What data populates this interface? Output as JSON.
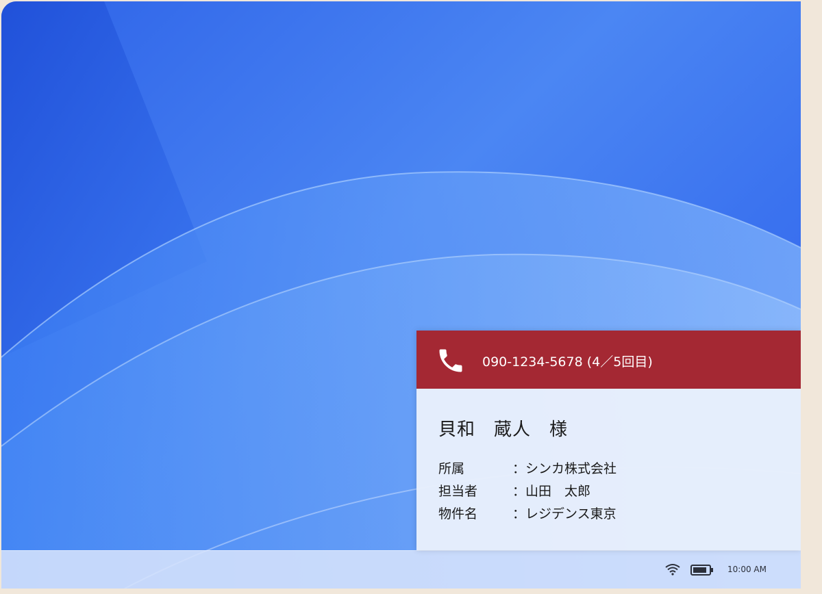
{
  "taskbar": {
    "wifi_icon": "wifi-icon",
    "battery_icon": "battery-icon",
    "clock": "10:00 AM"
  },
  "notification": {
    "accent_color": "#a42833",
    "icon": "phone-icon",
    "phone_line": "090-1234-5678 (4／5回目)",
    "caller_name": "貝和　蔵人　様",
    "separator": "：",
    "fields": [
      {
        "label": "所属",
        "value": "シンカ株式会社"
      },
      {
        "label": "担当者",
        "value": "山田　太郎"
      },
      {
        "label": "物件名",
        "value": "レジデンス東京"
      }
    ]
  }
}
